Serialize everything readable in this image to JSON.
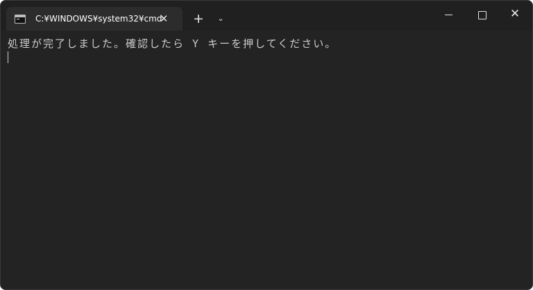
{
  "tab": {
    "title": "C:¥WINDOWS¥system32¥cmd",
    "icon": "console-app-icon",
    "close_icon": "close-icon"
  },
  "titlebar": {
    "new_tab_glyph": "+",
    "dropdown_glyph": "⌄",
    "close_glyph": "✕"
  },
  "console": {
    "lines": [
      "処理が完了しました。確認したら Y キーを押してください。"
    ]
  },
  "colors": {
    "titlebar_bg": "#202020",
    "tab_bg": "#2c2c2c",
    "console_bg": "#232323",
    "text": "#cccccc"
  }
}
